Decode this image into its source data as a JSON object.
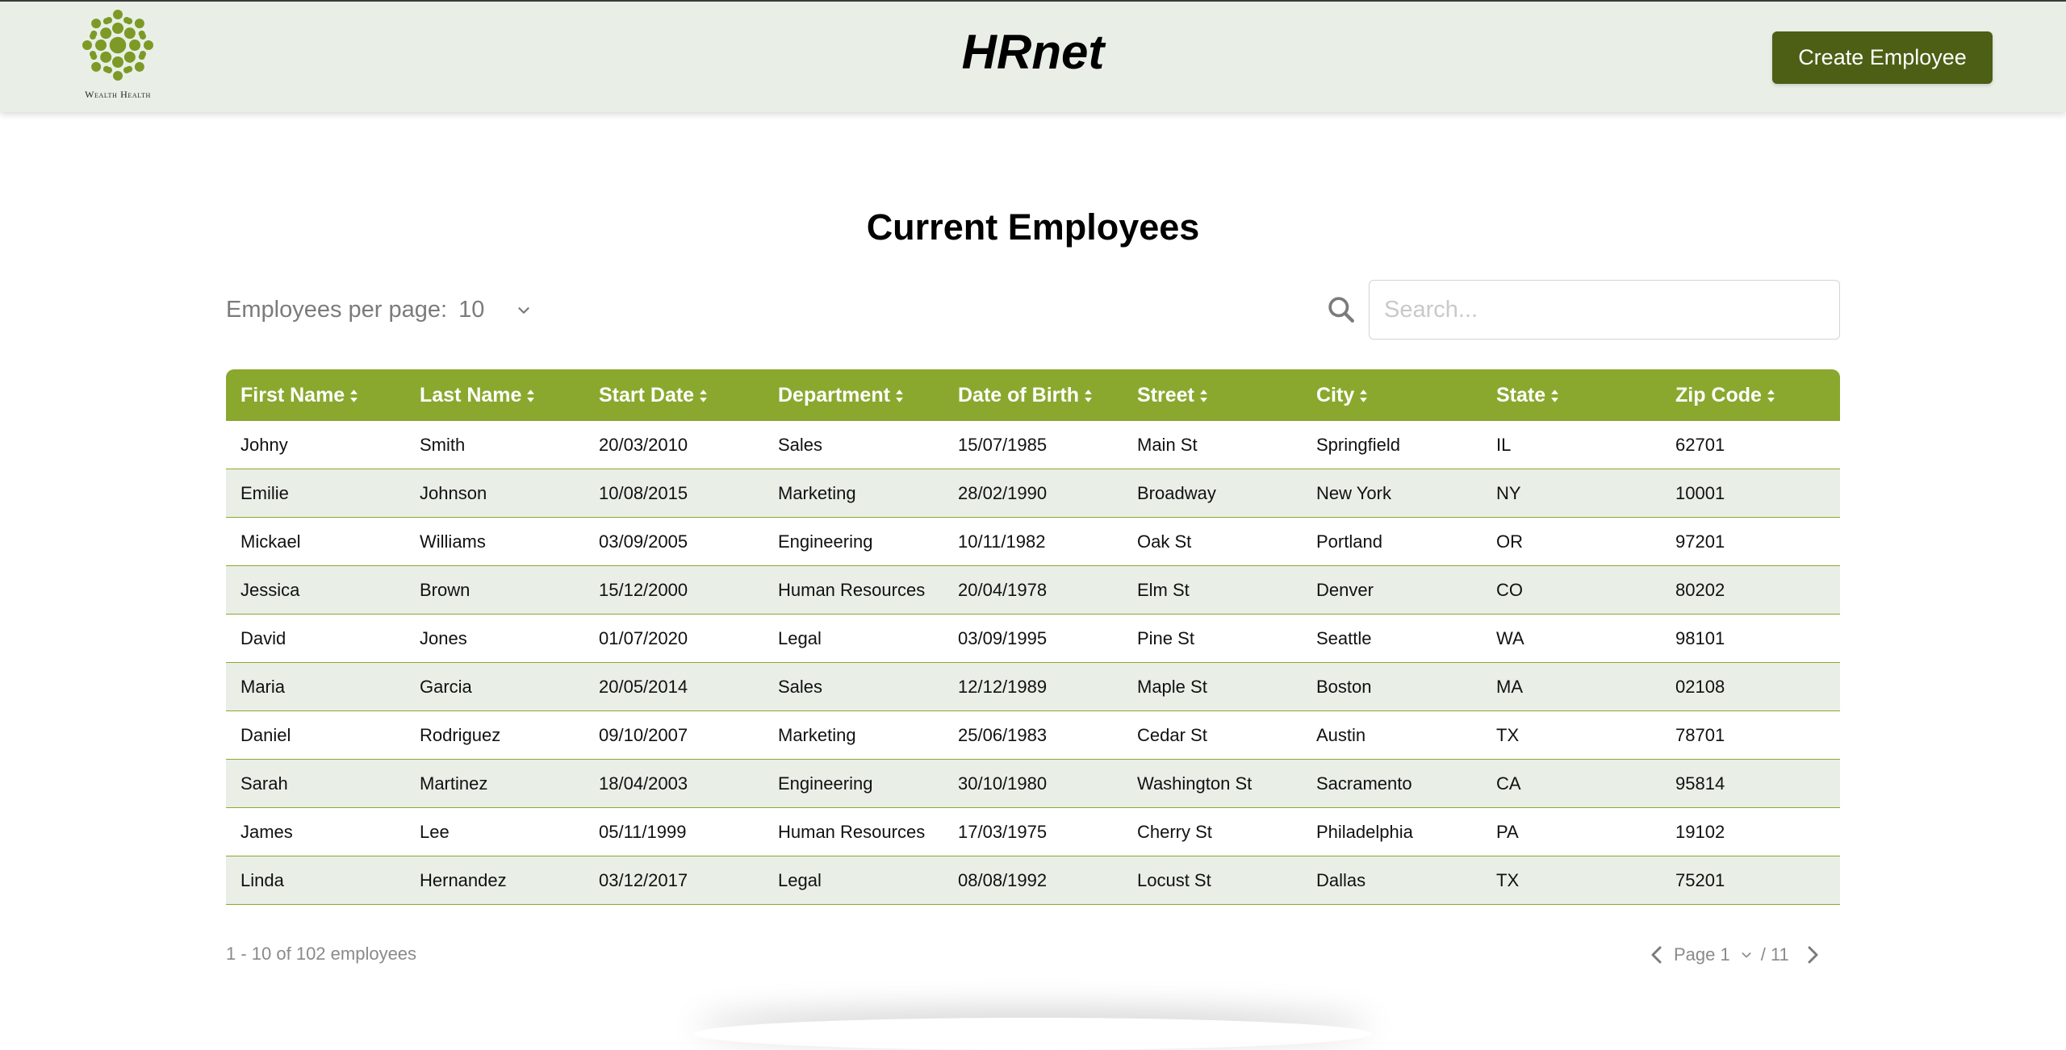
{
  "header": {
    "logo_text": "Wealth Health",
    "app_title": "HRnet",
    "create_button_label": "Create Employee"
  },
  "main": {
    "title": "Current Employees",
    "per_page_label": "Employees per page:",
    "per_page_value": "10",
    "search_placeholder": "Search..."
  },
  "table": {
    "columns": [
      "First Name",
      "Last Name",
      "Start Date",
      "Department",
      "Date of Birth",
      "Street",
      "City",
      "State",
      "Zip Code"
    ],
    "rows": [
      [
        "Johny",
        "Smith",
        "20/03/2010",
        "Sales",
        "15/07/1985",
        "Main St",
        "Springfield",
        "IL",
        "62701"
      ],
      [
        "Emilie",
        "Johnson",
        "10/08/2015",
        "Marketing",
        "28/02/1990",
        "Broadway",
        "New York",
        "NY",
        "10001"
      ],
      [
        "Mickael",
        "Williams",
        "03/09/2005",
        "Engineering",
        "10/11/1982",
        "Oak St",
        "Portland",
        "OR",
        "97201"
      ],
      [
        "Jessica",
        "Brown",
        "15/12/2000",
        "Human Resources",
        "20/04/1978",
        "Elm St",
        "Denver",
        "CO",
        "80202"
      ],
      [
        "David",
        "Jones",
        "01/07/2020",
        "Legal",
        "03/09/1995",
        "Pine St",
        "Seattle",
        "WA",
        "98101"
      ],
      [
        "Maria",
        "Garcia",
        "20/05/2014",
        "Sales",
        "12/12/1989",
        "Maple St",
        "Boston",
        "MA",
        "02108"
      ],
      [
        "Daniel",
        "Rodriguez",
        "09/10/2007",
        "Marketing",
        "25/06/1983",
        "Cedar St",
        "Austin",
        "TX",
        "78701"
      ],
      [
        "Sarah",
        "Martinez",
        "18/04/2003",
        "Engineering",
        "30/10/1980",
        "Washington St",
        "Sacramento",
        "CA",
        "95814"
      ],
      [
        "James",
        "Lee",
        "05/11/1999",
        "Human Resources",
        "17/03/1975",
        "Cherry St",
        "Philadelphia",
        "PA",
        "19102"
      ],
      [
        "Linda",
        "Hernandez",
        "03/12/2017",
        "Legal",
        "08/08/1992",
        "Locust St",
        "Dallas",
        "TX",
        "75201"
      ]
    ]
  },
  "footer": {
    "summary": "1 - 10 of 102 employees",
    "page_label": "Page 1",
    "total_pages": "/ 11"
  },
  "colors": {
    "header_bg": "#e9efe7",
    "accent_green": "#8aa82e",
    "button_green": "#4c5f14",
    "row_alt": "#e9efe7"
  },
  "icons": [
    "logo-icon",
    "chevron-down-icon",
    "search-icon",
    "sort-icon",
    "chevron-left-icon",
    "chevron-right-icon"
  ]
}
